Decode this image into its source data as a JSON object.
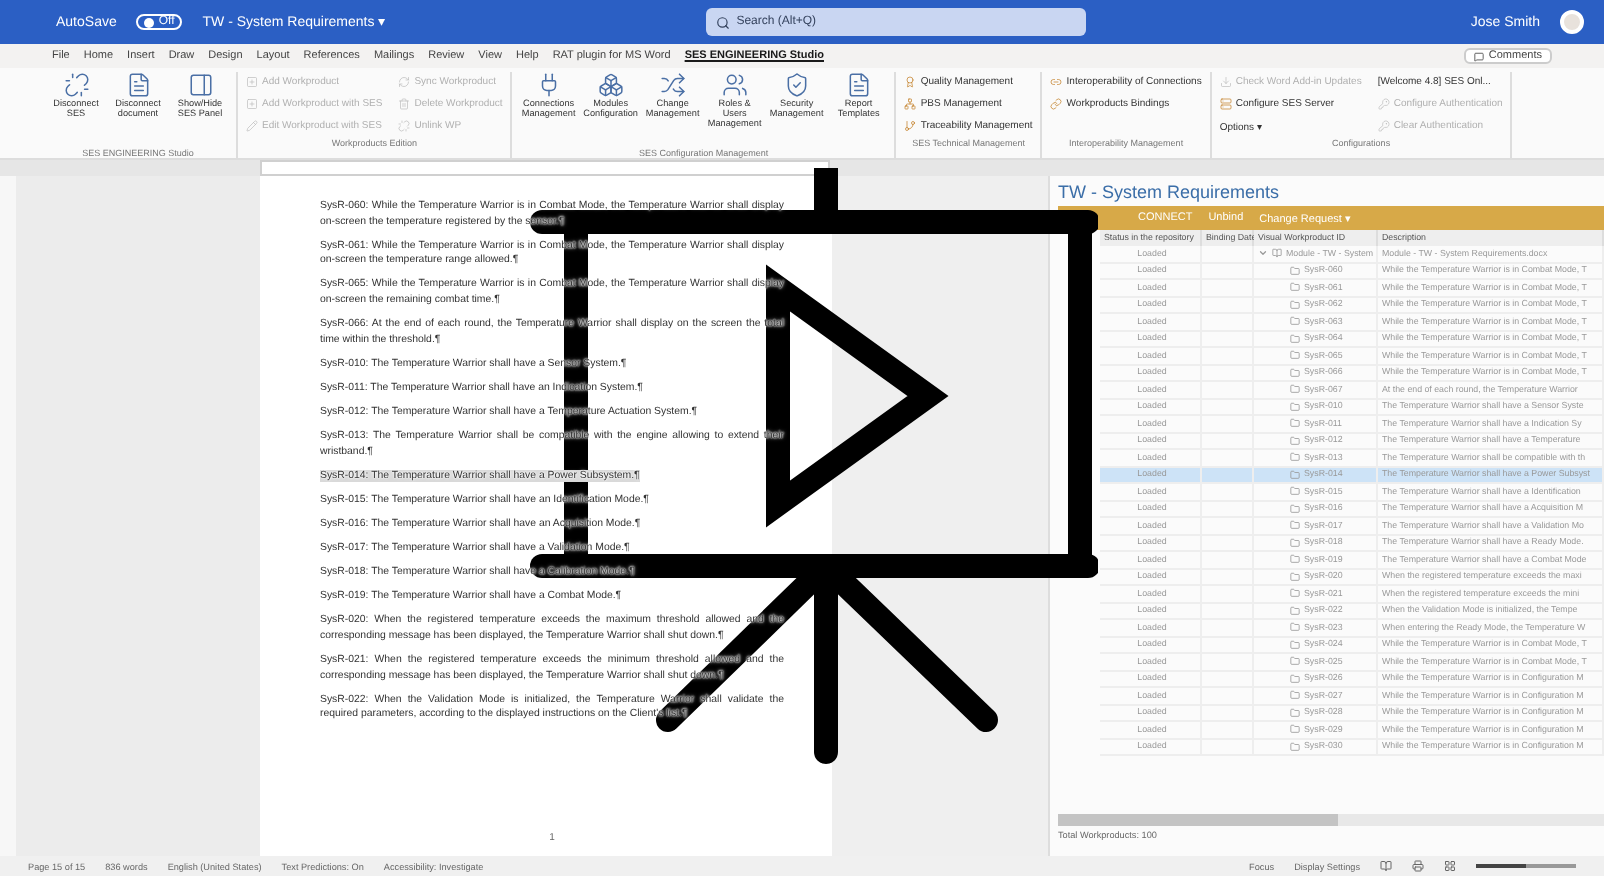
{
  "window": {
    "autosave_label": "AutoSave",
    "autosave_state": "Off",
    "autosave_on": false,
    "title": "TW - System Requirements ▾",
    "search": {
      "placeholder": "Search (Alt+Q)"
    },
    "user": "Jose Smith"
  },
  "menu_tabs": [
    {
      "label": "File",
      "selected": false
    },
    {
      "label": "Home",
      "selected": false
    },
    {
      "label": "Insert",
      "selected": false
    },
    {
      "label": "Draw",
      "selected": false
    },
    {
      "label": "Design",
      "selected": false
    },
    {
      "label": "Layout",
      "selected": false
    },
    {
      "label": "References",
      "selected": false
    },
    {
      "label": "Mailings",
      "selected": false
    },
    {
      "label": "Review",
      "selected": false
    },
    {
      "label": "View",
      "selected": false
    },
    {
      "label": "Help",
      "selected": false
    },
    {
      "label": "RAT plugin for MS Word",
      "selected": false
    },
    {
      "label": "SES ENGINEERING Studio",
      "selected": true
    }
  ],
  "comments_button": "Comments",
  "ribbon_groups": [
    {
      "title": "SES ENGINEERING Studio",
      "items": [
        {
          "kind": "large",
          "label": "Disconnect SES",
          "disabled": false
        },
        {
          "kind": "large",
          "label": "Disconnect document",
          "disabled": false
        },
        {
          "kind": "large",
          "label": "Show/Hide SES Panel",
          "disabled": false
        }
      ]
    },
    {
      "title": "Workproducts Edition",
      "items": [
        {
          "kind": "small",
          "label": "Add Workproduct",
          "disabled": true
        },
        {
          "kind": "small",
          "label": "Add Workproduct with SES",
          "disabled": true
        },
        {
          "kind": "small",
          "label": "Edit Workproduct with SES",
          "disabled": true
        },
        {
          "kind": "small",
          "label": "Sync Workproduct",
          "disabled": true
        },
        {
          "kind": "small",
          "label": "Delete Workproduct",
          "disabled": true
        },
        {
          "kind": "small",
          "label": "Unlink WP",
          "disabled": true
        }
      ]
    },
    {
      "title": "SES Configuration Management",
      "items": [
        {
          "kind": "large",
          "label": "Connections Management",
          "disabled": false
        },
        {
          "kind": "large",
          "label": "Modules Configuration",
          "disabled": false
        },
        {
          "kind": "large",
          "label": "Change Management",
          "disabled": false
        },
        {
          "kind": "large",
          "label": "Roles & Users Management",
          "disabled": false
        },
        {
          "kind": "large",
          "label": "Security Management",
          "disabled": false
        },
        {
          "kind": "large",
          "label": "Report Templates",
          "disabled": false
        }
      ]
    },
    {
      "title": "SES Technical Management",
      "items": [
        {
          "kind": "small",
          "label": "Quality Management",
          "disabled": false
        },
        {
          "kind": "small",
          "label": "PBS Management",
          "disabled": false
        },
        {
          "kind": "small",
          "label": "Traceability Management",
          "disabled": false
        }
      ]
    },
    {
      "title": "Interoperability Management",
      "items": [
        {
          "kind": "small",
          "label": "Interoperability of Connections",
          "disabled": false
        },
        {
          "kind": "small",
          "label": "Workproducts Bindings",
          "disabled": false
        }
      ]
    },
    {
      "title": "Configurations",
      "items": [
        {
          "kind": "small",
          "label": "Check Word Add-in Updates",
          "disabled": true
        },
        {
          "kind": "small",
          "label": "Configure SES Server",
          "disabled": false
        },
        {
          "kind": "small",
          "label": "Options ▾",
          "disabled": false
        },
        {
          "kind": "small",
          "label": "[Welcome 4.8] SES Onl...",
          "disabled": false
        },
        {
          "kind": "small",
          "label": "Configure Authentication",
          "disabled": true
        },
        {
          "kind": "small",
          "label": "Clear Authentication",
          "disabled": true
        }
      ]
    }
  ],
  "document": {
    "paragraphs": [
      {
        "text": "SysR-060: While the Temperature Warrior is in Combat Mode, the Temperature Warrior shall display on-screen the temperature registered by the sensor.¶",
        "highlighted": false
      },
      {
        "text": "SysR-061: While the Temperature Warrior is in Combat Mode, the Temperature Warrior shall display on-screen the temperature range allowed.¶",
        "highlighted": false
      },
      {
        "text": "SysR-065: While the Temperature Warrior is in Combat Mode, the Temperature Warrior shall display on-screen the remaining combat time.¶",
        "highlighted": false
      },
      {
        "text": "SysR-066: At the end of each round, the Temperature Warrior shall display on the screen the total time within the threshold.¶",
        "highlighted": false
      },
      {
        "text": "SysR-010: The Temperature Warrior shall have a Sensor System.¶",
        "highlighted": false
      },
      {
        "text": "SysR-011: The Temperature Warrior shall have an Indication System.¶",
        "highlighted": false
      },
      {
        "text": "SysR-012: The Temperature Warrior shall have a Temperature Actuation System.¶",
        "highlighted": false
      },
      {
        "text": "SysR-013: The Temperature Warrior shall be compatible with the engine allowing to extend their wristband.¶",
        "highlighted": false
      },
      {
        "text": "SysR-014: The Temperature Warrior shall have a Power Subsystem.¶",
        "highlighted": true
      },
      {
        "text": "SysR-015: The Temperature Warrior shall have an Identification Mode.¶",
        "highlighted": false
      },
      {
        "text": "SysR-016: The Temperature Warrior shall have an Acquisition Mode.¶",
        "highlighted": false
      },
      {
        "text": "SysR-017: The Temperature Warrior shall have a Validation Mode.¶",
        "highlighted": false
      },
      {
        "text": "SysR-018: The Temperature Warrior shall have a Calibration Mode.¶",
        "highlighted": false
      },
      {
        "text": "SysR-019: The Temperature Warrior shall have a Combat Mode.¶",
        "highlighted": false
      },
      {
        "text": "SysR-020: When the registered temperature exceeds the maximum threshold allowed and the corresponding message has been displayed, the Temperature Warrior shall shut down.¶",
        "highlighted": false
      },
      {
        "text": "SysR-021: When the registered temperature exceeds the minimum threshold allowed and the corresponding message has been displayed, the Temperature Warrior shall shut down.¶",
        "highlighted": false
      },
      {
        "text": "SysR-022: When the Validation Mode is initialized, the Temperature Warrior shall validate the required parameters, according to the displayed instructions on the Client's list.¶",
        "highlighted": false
      }
    ],
    "page_number": "1"
  },
  "panel": {
    "title": "TW - System Requirements",
    "toolbar": [
      "CONNECT",
      "Unbind",
      "Change Request ▾"
    ],
    "columns": [
      "Status in the repository",
      "Binding Date",
      "Visual Workproduct ID",
      "Description"
    ],
    "rows": [
      {
        "status": "Loaded",
        "id": "Module - TW - System",
        "description": "Module - TW - System Requirements.docx",
        "kind": "module",
        "selected": false
      },
      {
        "status": "Loaded",
        "id": "SysR-060",
        "description": "While the Temperature Warrior is in Combat Mode, T",
        "kind": "item",
        "selected": false
      },
      {
        "status": "Loaded",
        "id": "SysR-061",
        "description": "While the Temperature Warrior is in Combat Mode, T",
        "kind": "item",
        "selected": false
      },
      {
        "status": "Loaded",
        "id": "SysR-062",
        "description": "While the Temperature Warrior is in Combat Mode, T",
        "kind": "item",
        "selected": false
      },
      {
        "status": "Loaded",
        "id": "SysR-063",
        "description": "While the Temperature Warrior is in Combat Mode, T",
        "kind": "item",
        "selected": false
      },
      {
        "status": "Loaded",
        "id": "SysR-064",
        "description": "While the Temperature Warrior is in Combat Mode, T",
        "kind": "item",
        "selected": false
      },
      {
        "status": "Loaded",
        "id": "SysR-065",
        "description": "While the Temperature Warrior is in Combat Mode, T",
        "kind": "item",
        "selected": false
      },
      {
        "status": "Loaded",
        "id": "SysR-066",
        "description": "While the Temperature Warrior is in Combat Mode, T",
        "kind": "item",
        "selected": false
      },
      {
        "status": "Loaded",
        "id": "SysR-067",
        "description": "At the end of each round, the Temperature Warrior",
        "kind": "item",
        "selected": false
      },
      {
        "status": "Loaded",
        "id": "SysR-010",
        "description": "The Temperature Warrior shall have a Sensor Syste",
        "kind": "item",
        "selected": false
      },
      {
        "status": "Loaded",
        "id": "SysR-011",
        "description": "The Temperature Warrior shall have a Indication Sy",
        "kind": "item",
        "selected": false
      },
      {
        "status": "Loaded",
        "id": "SysR-012",
        "description": "The Temperature Warrior shall have a Temperature",
        "kind": "item",
        "selected": false
      },
      {
        "status": "Loaded",
        "id": "SysR-013",
        "description": "The Temperature Warrior shall be compatible with th",
        "kind": "item",
        "selected": false
      },
      {
        "status": "Loaded",
        "id": "SysR-014",
        "description": "The Temperature Warrior shall have a Power Subsyst",
        "kind": "item",
        "selected": true
      },
      {
        "status": "Loaded",
        "id": "SysR-015",
        "description": "The Temperature Warrior shall have a Identification",
        "kind": "item",
        "selected": false
      },
      {
        "status": "Loaded",
        "id": "SysR-016",
        "description": "The Temperature Warrior shall have a Acquisition M",
        "kind": "item",
        "selected": false
      },
      {
        "status": "Loaded",
        "id": "SysR-017",
        "description": "The Temperature Warrior shall have a Validation Mo",
        "kind": "item",
        "selected": false
      },
      {
        "status": "Loaded",
        "id": "SysR-018",
        "description": "The Temperature Warrior shall have a Ready Mode.",
        "kind": "item",
        "selected": false
      },
      {
        "status": "Loaded",
        "id": "SysR-019",
        "description": "The Temperature Warrior shall have a Combat Mode",
        "kind": "item",
        "selected": false
      },
      {
        "status": "Loaded",
        "id": "SysR-020",
        "description": "When the registered temperature exceeds the maxi",
        "kind": "item",
        "selected": false
      },
      {
        "status": "Loaded",
        "id": "SysR-021",
        "description": "When the registered temperature exceeds the mini",
        "kind": "item",
        "selected": false
      },
      {
        "status": "Loaded",
        "id": "SysR-022",
        "description": "When the Validation Mode is initialized, the Tempe",
        "kind": "item",
        "selected": false
      },
      {
        "status": "Loaded",
        "id": "SysR-023",
        "description": "When entering the Ready Mode, the Temperature W",
        "kind": "item",
        "selected": false
      },
      {
        "status": "Loaded",
        "id": "SysR-024",
        "description": "While the Temperature Warrior is in Combat Mode, T",
        "kind": "item",
        "selected": false
      },
      {
        "status": "Loaded",
        "id": "SysR-025",
        "description": "While the Temperature Warrior is in Combat Mode, T",
        "kind": "item",
        "selected": false
      },
      {
        "status": "Loaded",
        "id": "SysR-026",
        "description": "While the Temperature Warrior is in Configuration M",
        "kind": "item",
        "selected": false
      },
      {
        "status": "Loaded",
        "id": "SysR-027",
        "description": "While the Temperature Warrior is in Configuration M",
        "kind": "item",
        "selected": false
      },
      {
        "status": "Loaded",
        "id": "SysR-028",
        "description": "While the Temperature Warrior is in Configuration M",
        "kind": "item",
        "selected": false
      },
      {
        "status": "Loaded",
        "id": "SysR-029",
        "description": "While the Temperature Warrior is in Configuration M",
        "kind": "item",
        "selected": false
      },
      {
        "status": "Loaded",
        "id": "SysR-030",
        "description": "While the Temperature Warrior is in Configuration M",
        "kind": "item",
        "selected": false
      }
    ],
    "footer": "Total Workproducts: 100"
  },
  "status_bar": {
    "left": [
      "Page 15 of 15",
      "836 words",
      "English (United States)",
      "Text Predictions: On",
      "Accessibility: Investigate"
    ],
    "right": [
      "Focus",
      "Display Settings"
    ],
    "zoom_slider": {
      "level": 0.5
    }
  }
}
